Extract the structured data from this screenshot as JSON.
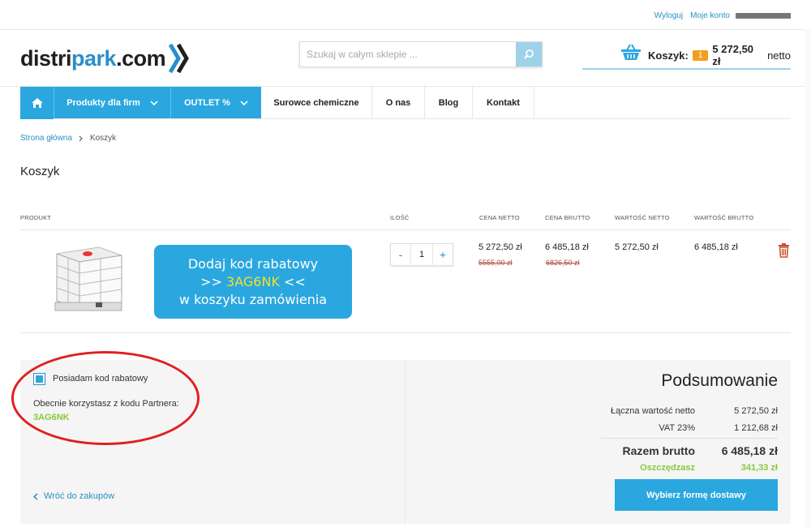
{
  "toplinks": {
    "logout": "Wyloguj",
    "account": "Moje konto"
  },
  "logo": {
    "part1": "distri",
    "part2": "park",
    "part3": ".com"
  },
  "search": {
    "placeholder": "Szukaj w całym sklepie ..."
  },
  "cart": {
    "label": "Koszyk:",
    "count": "1",
    "amount": "5 272,50 zł",
    "suffix": "netto"
  },
  "nav": {
    "items": [
      "Produkty dla firm",
      "OUTLET %",
      "Surowce chemiczne",
      "O nas",
      "Blog",
      "Kontakt"
    ]
  },
  "breadcrumb": {
    "home": "Strona główna",
    "current": "Koszyk"
  },
  "page_title": "Koszyk",
  "table": {
    "headers": [
      "PRODUKT",
      "ILOŚĆ",
      "CENA NETTO",
      "CENA BRUTTO",
      "WARTOŚĆ NETTO",
      "WARTOŚĆ BRUTTO"
    ],
    "row": {
      "quantity": "1",
      "minus": "-",
      "plus": "+",
      "price_net": "5 272,50 zł",
      "price_net_old": "5555,00 zł",
      "price_gross": "6 485,18 zł",
      "price_gross_old": "6826,50 zł",
      "value_net": "5 272,50 zł",
      "value_gross": "6 485,18 zł"
    }
  },
  "promo": {
    "line1": "Dodaj kod rabatowy",
    "line2_pre": ">> ",
    "code": "3AG6NK",
    "line2_post": " <<",
    "line3": "w koszyku zamówienia"
  },
  "discount": {
    "checkbox_label": "Posiadam kod rabatowy",
    "info": "Obecnie korzystasz z kodu Partnera:",
    "code": "3AG6NK"
  },
  "back_link": "Wróć do zakupów",
  "summary": {
    "title": "Podsumowanie",
    "net_label": "Łączna wartość netto",
    "net_value": "5 272,50 zł",
    "vat_label": "VAT 23%",
    "vat_value": "1 212,68 zł",
    "gross_label": "Razem brutto",
    "gross_value": "6 485,18 zł",
    "save_label": "Oszczędzasz",
    "save_value": "341,33 zł",
    "button": "Wybierz formę dostawy"
  },
  "colors": {
    "accent": "#2aa7df",
    "link": "#2a8fc8",
    "badge": "#f0a020",
    "save": "#8dc63f",
    "old_price": "#b24a3a"
  }
}
